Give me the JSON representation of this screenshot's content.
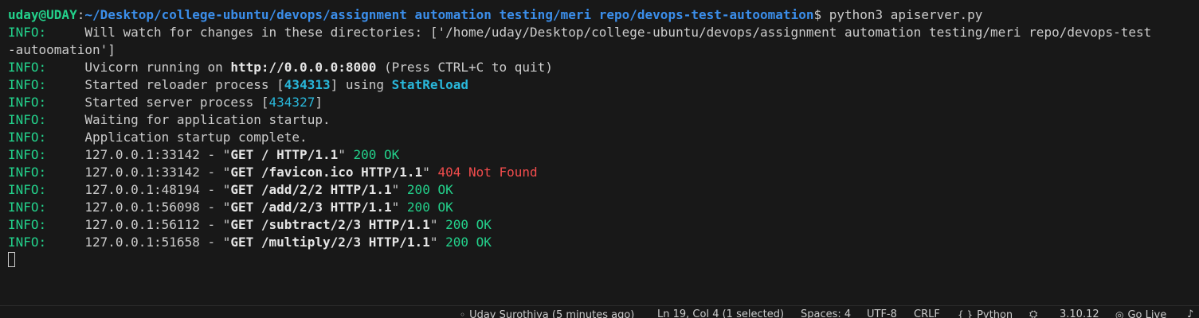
{
  "terminal": {
    "prompt": {
      "user": "uday@UDAY",
      "sep": ":",
      "path": "~/Desktop/college-ubuntu/devops/assignment automation testing/meri repo/devops-test-autoomation",
      "symbol": "$ ",
      "command": "python3 apiserver.py"
    },
    "lines": [
      {
        "level": "INFO:",
        "text": "     Will watch for changes in these directories: ['/home/uday/Desktop/college-ubuntu/devops/assignment automation testing/meri repo/devops-test"
      },
      {
        "wrap": "-autoomation']"
      },
      {
        "level": "INFO:",
        "pre": "     Uvicorn running on ",
        "url": "http://0.0.0.0:8000",
        "post": " (Press CTRL+C to quit)"
      },
      {
        "level": "INFO:",
        "pre": "     Started reloader process [",
        "pid": "434313",
        "mid": "] using ",
        "reloader": "StatReload"
      },
      {
        "level": "INFO:",
        "pre": "     Started server process [",
        "pid": "434327",
        "post": "]"
      },
      {
        "level": "INFO:",
        "text": "     Waiting for application startup."
      },
      {
        "level": "INFO:",
        "text": "     Application startup complete."
      },
      {
        "level": "INFO:",
        "client": "     127.0.0.1:33142 - \"",
        "request": "GET / HTTP/1.1",
        "close": "\" ",
        "status": "200 OK",
        "status_color": "green"
      },
      {
        "level": "INFO:",
        "client": "     127.0.0.1:33142 - \"",
        "request": "GET /favicon.ico HTTP/1.1",
        "close": "\" ",
        "status": "404 Not Found",
        "status_color": "red"
      },
      {
        "level": "INFO:",
        "client": "     127.0.0.1:48194 - \"",
        "request": "GET /add/2/2 HTTP/1.1",
        "close": "\" ",
        "status": "200 OK",
        "status_color": "green"
      },
      {
        "level": "INFO:",
        "client": "     127.0.0.1:56098 - \"",
        "request": "GET /add/2/3 HTTP/1.1",
        "close": "\" ",
        "status": "200 OK",
        "status_color": "green"
      },
      {
        "level": "INFO:",
        "client": "     127.0.0.1:56112 - \"",
        "request": "GET /subtract/2/3 HTTP/1.1",
        "close": "\" ",
        "status": "200 OK",
        "status_color": "green"
      },
      {
        "level": "INFO:",
        "client": "     127.0.0.1:51658 - \"",
        "request": "GET /multiply/2/3 HTTP/1.1",
        "close": "\" ",
        "status": "200 OK",
        "status_color": "green"
      }
    ]
  },
  "statusbar": {
    "blame": "Uday Surothiya (5 minutes ago)",
    "position": "Ln 19, Col 4 (1 selected)",
    "spaces": "Spaces: 4",
    "encoding": "UTF-8",
    "eol": "CRLF",
    "language_icon": "{ }",
    "language": "Python",
    "version": "3.10.12",
    "golive": "Go Live"
  },
  "colors": {
    "background": "#181818",
    "text": "#cccccc",
    "green": "#23d18b",
    "blue": "#3b8eea",
    "cyan": "#29b8db",
    "red": "#f14c4c"
  }
}
